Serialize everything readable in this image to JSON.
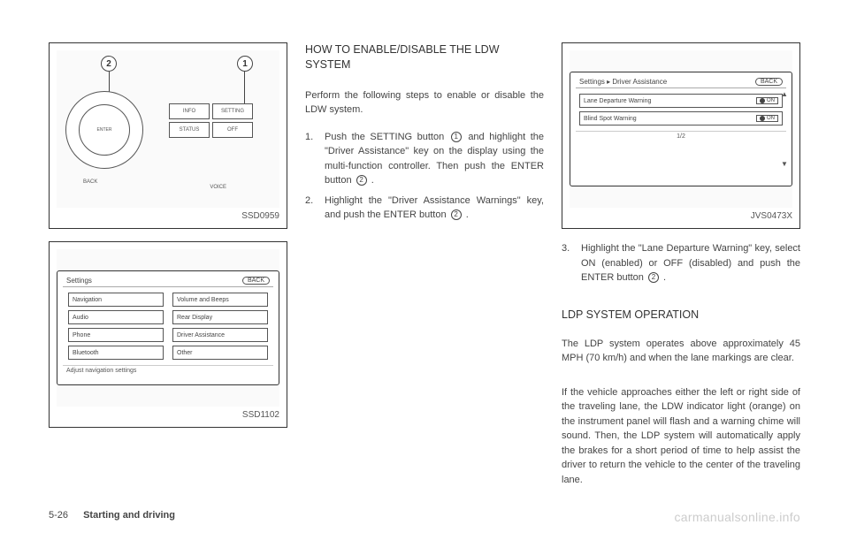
{
  "figures": {
    "fig1": {
      "label": "SSD0959",
      "callout1": "1",
      "callout2": "2",
      "enter": "ENTER",
      "buttons": [
        "INFO",
        "SETTING",
        "STATUS",
        "OFF"
      ],
      "back": "BACK",
      "voice": "VOICE"
    },
    "fig2": {
      "label": "SSD1102",
      "title": "Settings",
      "back": "BACK",
      "options": [
        "Navigation",
        "Volume and Beeps",
        "Audio",
        "Rear Display",
        "Phone",
        "Driver Assistance",
        "Bluetooth",
        "Other"
      ],
      "bottom": "Adjust navigation settings"
    },
    "fig3": {
      "label": "JVS0473X",
      "crumb": "Settings ▸ Driver Assistance",
      "back": "BACK",
      "rows": [
        {
          "label": "Lane Departure Warning",
          "toggle": "ON"
        },
        {
          "label": "Blind Spot Warning",
          "toggle": "ON"
        }
      ],
      "page": "1/2"
    }
  },
  "col2": {
    "heading": "HOW TO ENABLE/DISABLE THE LDW SYSTEM",
    "intro": "Perform the following steps to enable or disable the LDW system.",
    "step1_num": "1.",
    "step1a": "Push the SETTING button",
    "step1b": "and highlight the \"Driver Assistance\" key on the display using the multi-function controller. Then push the ENTER button",
    "step1c": ".",
    "step2_num": "2.",
    "step2a": "Highlight the \"Driver Assistance Warnings\" key, and push the ENTER button",
    "step2b": ".",
    "c1": "1",
    "c2": "2"
  },
  "col3": {
    "step3_num": "3.",
    "step3a": "Highlight the \"Lane Departure Warning\" key, select ON (enabled) or OFF (disabled) and push the ENTER button",
    "step3b": ".",
    "c2": "2",
    "heading2": "LDP SYSTEM OPERATION",
    "p1": "The LDP system operates above approximately 45 MPH (70 km/h) and when the lane markings are clear.",
    "p2": "If the vehicle approaches either the left or right side of the traveling lane, the LDW indicator light (orange) on the instrument panel will flash and a warning chime will sound. Then, the LDP system will automatically apply the brakes for a short period of time to help assist the driver to return the vehicle to the center of the traveling lane."
  },
  "footer": {
    "page": "5-26",
    "section": "Starting and driving"
  },
  "watermark": "carmanualsonline.info"
}
